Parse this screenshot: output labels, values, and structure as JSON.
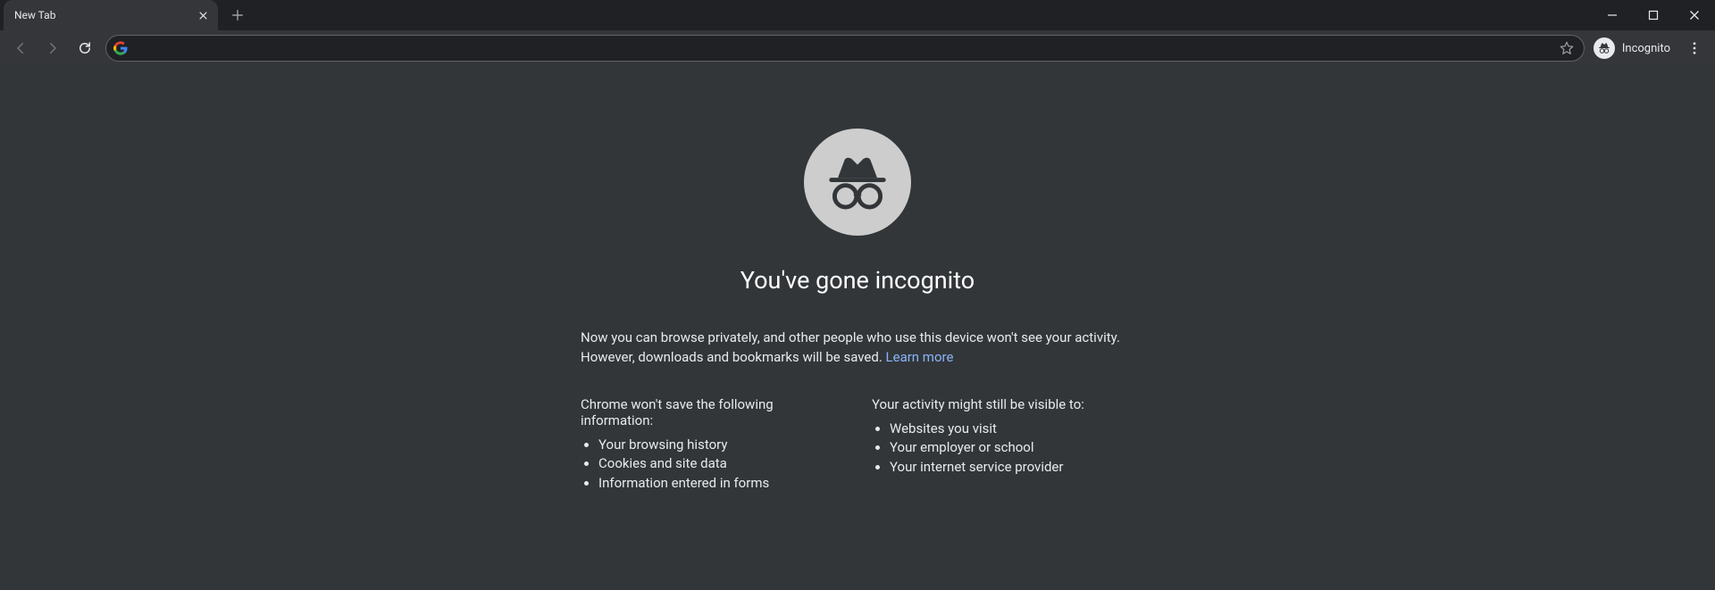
{
  "tab": {
    "title": "New Tab"
  },
  "toolbar": {
    "incognito_label": "Incognito",
    "omnibox_value": "",
    "omnibox_placeholder": ""
  },
  "page": {
    "heading": "You've gone incognito",
    "intro_before_link": "Now you can browse privately, and other people who use this device won't see your activity. However, downloads and bookmarks will be saved. ",
    "learn_more": "Learn more",
    "col1": {
      "lead": "Chrome won't save the following information:",
      "items": [
        "Your browsing history",
        "Cookies and site data",
        "Information entered in forms"
      ]
    },
    "col2": {
      "lead": "Your activity might still be visible to:",
      "items": [
        "Websites you visit",
        "Your employer or school",
        "Your internet service provider"
      ]
    }
  }
}
